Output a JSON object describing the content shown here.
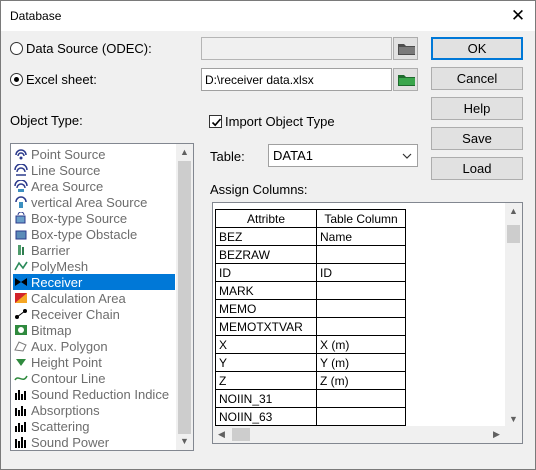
{
  "window": {
    "title": "Database",
    "close_glyph": "✕"
  },
  "source": {
    "odec_label": "Data Source (ODEC):",
    "excel_label": "Excel sheet:",
    "odec_path": "",
    "excel_path": "D:\\receiver data.xlsx",
    "selected": "excel"
  },
  "buttons": {
    "ok": "OK",
    "cancel": "Cancel",
    "help": "Help",
    "save": "Save",
    "load": "Load"
  },
  "object_type": {
    "label": "Object Type:",
    "items": [
      {
        "label": "Point Source",
        "icon": "point-source-icon",
        "enabled": false
      },
      {
        "label": "Line Source",
        "icon": "line-source-icon",
        "enabled": false
      },
      {
        "label": "Area Source",
        "icon": "area-source-icon",
        "enabled": false
      },
      {
        "label": "vertical Area Source",
        "icon": "vertical-area-source-icon",
        "enabled": false
      },
      {
        "label": "Box-type Source",
        "icon": "box-type-source-icon",
        "enabled": false
      },
      {
        "label": "Box-type Obstacle",
        "icon": "box-type-obstacle-icon",
        "enabled": false
      },
      {
        "label": "Barrier",
        "icon": "barrier-icon",
        "enabled": false
      },
      {
        "label": "PolyMesh",
        "icon": "polymesh-icon",
        "enabled": false
      },
      {
        "label": "Receiver",
        "icon": "receiver-icon",
        "enabled": true,
        "selected": true
      },
      {
        "label": "Calculation Area",
        "icon": "calculation-area-icon",
        "enabled": false
      },
      {
        "label": "Receiver Chain",
        "icon": "receiver-chain-icon",
        "enabled": false
      },
      {
        "label": "Bitmap",
        "icon": "bitmap-icon",
        "enabled": false
      },
      {
        "label": "Aux. Polygon",
        "icon": "aux-polygon-icon",
        "enabled": false
      },
      {
        "label": "Height Point",
        "icon": "height-point-icon",
        "enabled": false
      },
      {
        "label": "Contour Line",
        "icon": "contour-line-icon",
        "enabled": false
      },
      {
        "label": "Sound Reduction Indice",
        "icon": "sound-reduction-icon",
        "enabled": false
      },
      {
        "label": "Absorptions",
        "icon": "absorptions-icon",
        "enabled": false
      },
      {
        "label": "Scattering",
        "icon": "scattering-icon",
        "enabled": false
      },
      {
        "label": "Sound Power",
        "icon": "sound-power-icon",
        "enabled": false
      }
    ]
  },
  "import": {
    "checkbox_label": "Import Object Type",
    "checked": true
  },
  "table": {
    "label": "Table:",
    "value": "DATA1"
  },
  "assign": {
    "label": "Assign Columns:",
    "headers": [
      "Attribte",
      "Table Column"
    ],
    "rows": [
      [
        "BEZ",
        "Name"
      ],
      [
        "BEZRAW",
        ""
      ],
      [
        "ID",
        "ID"
      ],
      [
        "MARK",
        ""
      ],
      [
        "MEMO",
        ""
      ],
      [
        "MEMOTXTVAR",
        ""
      ],
      [
        "X",
        "X (m)"
      ],
      [
        "Y",
        "Y (m)"
      ],
      [
        "Z",
        "Z (m)"
      ],
      [
        "NOIIN_31",
        ""
      ],
      [
        "NOIIN_63",
        ""
      ]
    ]
  },
  "colors": {
    "selection": "#0078d7",
    "default_button_border": "#0078d7",
    "folder_icon": "#2f8a3e"
  }
}
